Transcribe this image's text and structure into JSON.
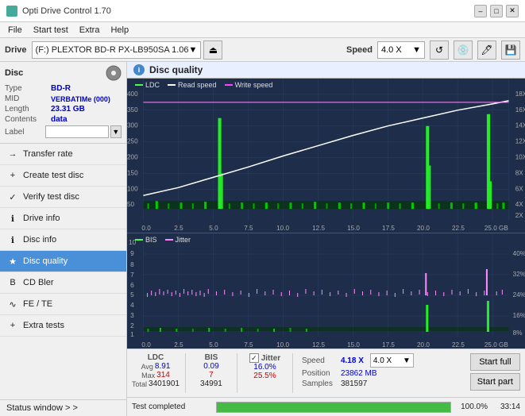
{
  "app": {
    "title": "Opti Drive Control 1.70",
    "icon": "disc-icon"
  },
  "title_controls": {
    "minimize": "–",
    "maximize": "□",
    "close": "✕"
  },
  "menu": {
    "items": [
      "File",
      "Start test",
      "Extra",
      "Help"
    ]
  },
  "drive_toolbar": {
    "label": "Drive",
    "drive_value": "(F:)  PLEXTOR BD-R  PX-LB950SA 1.06",
    "speed_label": "Speed",
    "speed_value": "4.0 X"
  },
  "disc_panel": {
    "title": "Disc",
    "rows": [
      {
        "label": "Type",
        "value": "BD-R"
      },
      {
        "label": "MID",
        "value": "VERBATIMe (000)"
      },
      {
        "label": "Length",
        "value": "23.31 GB"
      },
      {
        "label": "Contents",
        "value": "data"
      }
    ],
    "label_placeholder": ""
  },
  "nav_items": [
    {
      "label": "Transfer rate",
      "icon": "→",
      "active": false
    },
    {
      "label": "Create test disc",
      "icon": "+",
      "active": false
    },
    {
      "label": "Verify test disc",
      "icon": "✓",
      "active": false
    },
    {
      "label": "Drive info",
      "icon": "i",
      "active": false
    },
    {
      "label": "Disc info",
      "icon": "i",
      "active": false
    },
    {
      "label": "Disc quality",
      "icon": "★",
      "active": true
    },
    {
      "label": "CD Bler",
      "icon": "B",
      "active": false
    },
    {
      "label": "FE / TE",
      "icon": "~",
      "active": false
    },
    {
      "label": "Extra tests",
      "icon": "+",
      "active": false
    }
  ],
  "status_window": {
    "label": "Status window > >"
  },
  "disc_quality": {
    "title": "Disc quality"
  },
  "upper_chart": {
    "legend": [
      {
        "label": "LDC",
        "color": "#44ff44"
      },
      {
        "label": "Read speed",
        "color": "#ffffff"
      },
      {
        "label": "Write speed",
        "color": "#ff44ff"
      }
    ],
    "y_right_labels": [
      "18X",
      "16X",
      "14X",
      "12X",
      "10X",
      "8X",
      "6X",
      "4X",
      "2X"
    ],
    "y_left_labels": [
      "400",
      "350",
      "300",
      "250",
      "200",
      "150",
      "100",
      "50"
    ],
    "x_labels": [
      "0.0",
      "2.5",
      "5.0",
      "7.5",
      "10.0",
      "12.5",
      "15.0",
      "17.5",
      "20.0",
      "22.5",
      "25.0 GB"
    ]
  },
  "lower_chart": {
    "legend": [
      {
        "label": "BIS",
        "color": "#44ff44"
      },
      {
        "label": "Jitter",
        "color": "#ff88ff"
      }
    ],
    "y_right_labels": [
      "40%",
      "32%",
      "24%",
      "16%",
      "8%"
    ],
    "y_left_labels": [
      "10",
      "9",
      "8",
      "7",
      "6",
      "5",
      "4",
      "3",
      "2",
      "1"
    ],
    "x_labels": [
      "0.0",
      "2.5",
      "5.0",
      "7.5",
      "10.0",
      "12.5",
      "15.0",
      "17.5",
      "20.0",
      "22.5",
      "25.0 GB"
    ]
  },
  "stats": {
    "columns": [
      {
        "header": "LDC",
        "avg": "8.91",
        "max": "314",
        "total": "3401901"
      },
      {
        "header": "BIS",
        "avg": "0.09",
        "max": "7",
        "total": "34991"
      }
    ],
    "jitter": {
      "checked": true,
      "label": "Jitter",
      "avg": "16.0%",
      "max": "25.5%",
      "total": ""
    },
    "speed": {
      "label": "Speed",
      "value": "4.18 X",
      "dropdown": "4.0 X"
    },
    "position": {
      "label": "Position",
      "value": "23862 MB"
    },
    "samples": {
      "label": "Samples",
      "value": "381597"
    },
    "rows": [
      "Avg",
      "Max",
      "Total"
    ]
  },
  "buttons": {
    "start_full": "Start full",
    "start_part": "Start part"
  },
  "progress": {
    "percent": 100,
    "percent_label": "100.0%",
    "status": "Test completed",
    "time": "33:14"
  }
}
